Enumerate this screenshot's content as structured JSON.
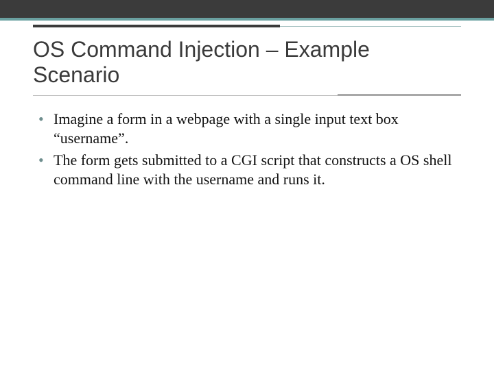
{
  "title": "OS Command Injection – Example Scenario",
  "bullets": [
    "Imagine a form in a webpage with a single input text box “username”.",
    "The form gets submitted to a CGI script that constructs a OS shell command line with the username and runs it."
  ]
}
